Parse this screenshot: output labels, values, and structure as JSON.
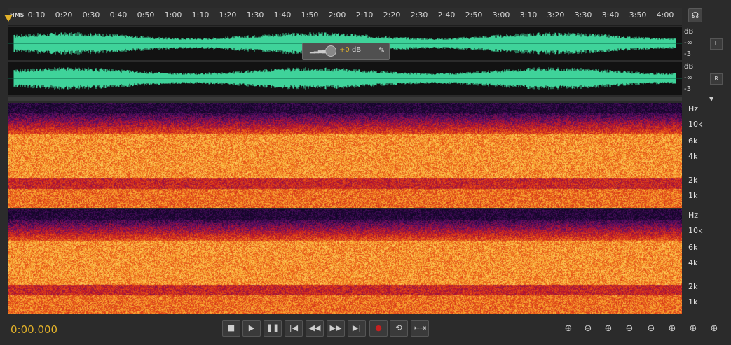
{
  "ruler": {
    "hms_label": "HMS",
    "ticks": [
      "0:10",
      "0:20",
      "0:30",
      "0:40",
      "0:50",
      "1:00",
      "1:10",
      "1:20",
      "1:30",
      "1:40",
      "1:50",
      "2:00",
      "2:10",
      "2:20",
      "2:30",
      "2:40",
      "2:50",
      "3:00",
      "3:10",
      "3:20",
      "3:30",
      "3:40",
      "3:50",
      "4:00"
    ]
  },
  "channels": {
    "left": {
      "button": "L",
      "scale": [
        "dB",
        "-∞",
        "-3"
      ]
    },
    "right": {
      "button": "R",
      "scale": [
        "dB",
        "-∞",
        "-3"
      ]
    }
  },
  "hud": {
    "value": "+0",
    "unit": "dB"
  },
  "spectral": {
    "top_scale": [
      "Hz",
      "10k",
      "6k",
      "4k",
      "2k",
      "1k"
    ],
    "bottom_scale": [
      "Hz",
      "10k",
      "6k",
      "4k",
      "2k",
      "1k"
    ]
  },
  "transport": {
    "time": "0:00.000",
    "buttons": [
      {
        "name": "stop-button",
        "glyph": "■"
      },
      {
        "name": "play-button",
        "glyph": "▶"
      },
      {
        "name": "pause-button",
        "glyph": "❚❚"
      },
      {
        "name": "go-to-start-button",
        "glyph": "|◀"
      },
      {
        "name": "rewind-button",
        "glyph": "◀◀"
      },
      {
        "name": "fast-forward-button",
        "glyph": "▶▶"
      },
      {
        "name": "go-to-end-button",
        "glyph": "▶|"
      },
      {
        "name": "record-button",
        "glyph": "●"
      },
      {
        "name": "loop-button",
        "glyph": "⟲"
      },
      {
        "name": "skip-selection-button",
        "glyph": "⇤⇥"
      }
    ]
  },
  "zoom": {
    "buttons": [
      {
        "name": "zoom-in-amplitude-icon",
        "glyph": "⊕"
      },
      {
        "name": "zoom-out-amplitude-icon",
        "glyph": "⊖"
      },
      {
        "name": "zoom-in-time-icon",
        "glyph": "⊕"
      },
      {
        "name": "zoom-out-time-icon",
        "glyph": "⊖"
      },
      {
        "name": "zoom-out-full-icon",
        "glyph": "⊖"
      },
      {
        "name": "zoom-in-at-start-icon",
        "glyph": "⊕"
      },
      {
        "name": "zoom-in-at-end-icon",
        "glyph": "⊕"
      },
      {
        "name": "zoom-selection-icon",
        "glyph": "⊕"
      }
    ]
  },
  "colors": {
    "waveform": "#3fd39a",
    "accent": "#e3b22a",
    "spectral_low": "#1a0a3a",
    "spectral_mid": "#d0201c",
    "spectral_high": "#ffd45a"
  }
}
